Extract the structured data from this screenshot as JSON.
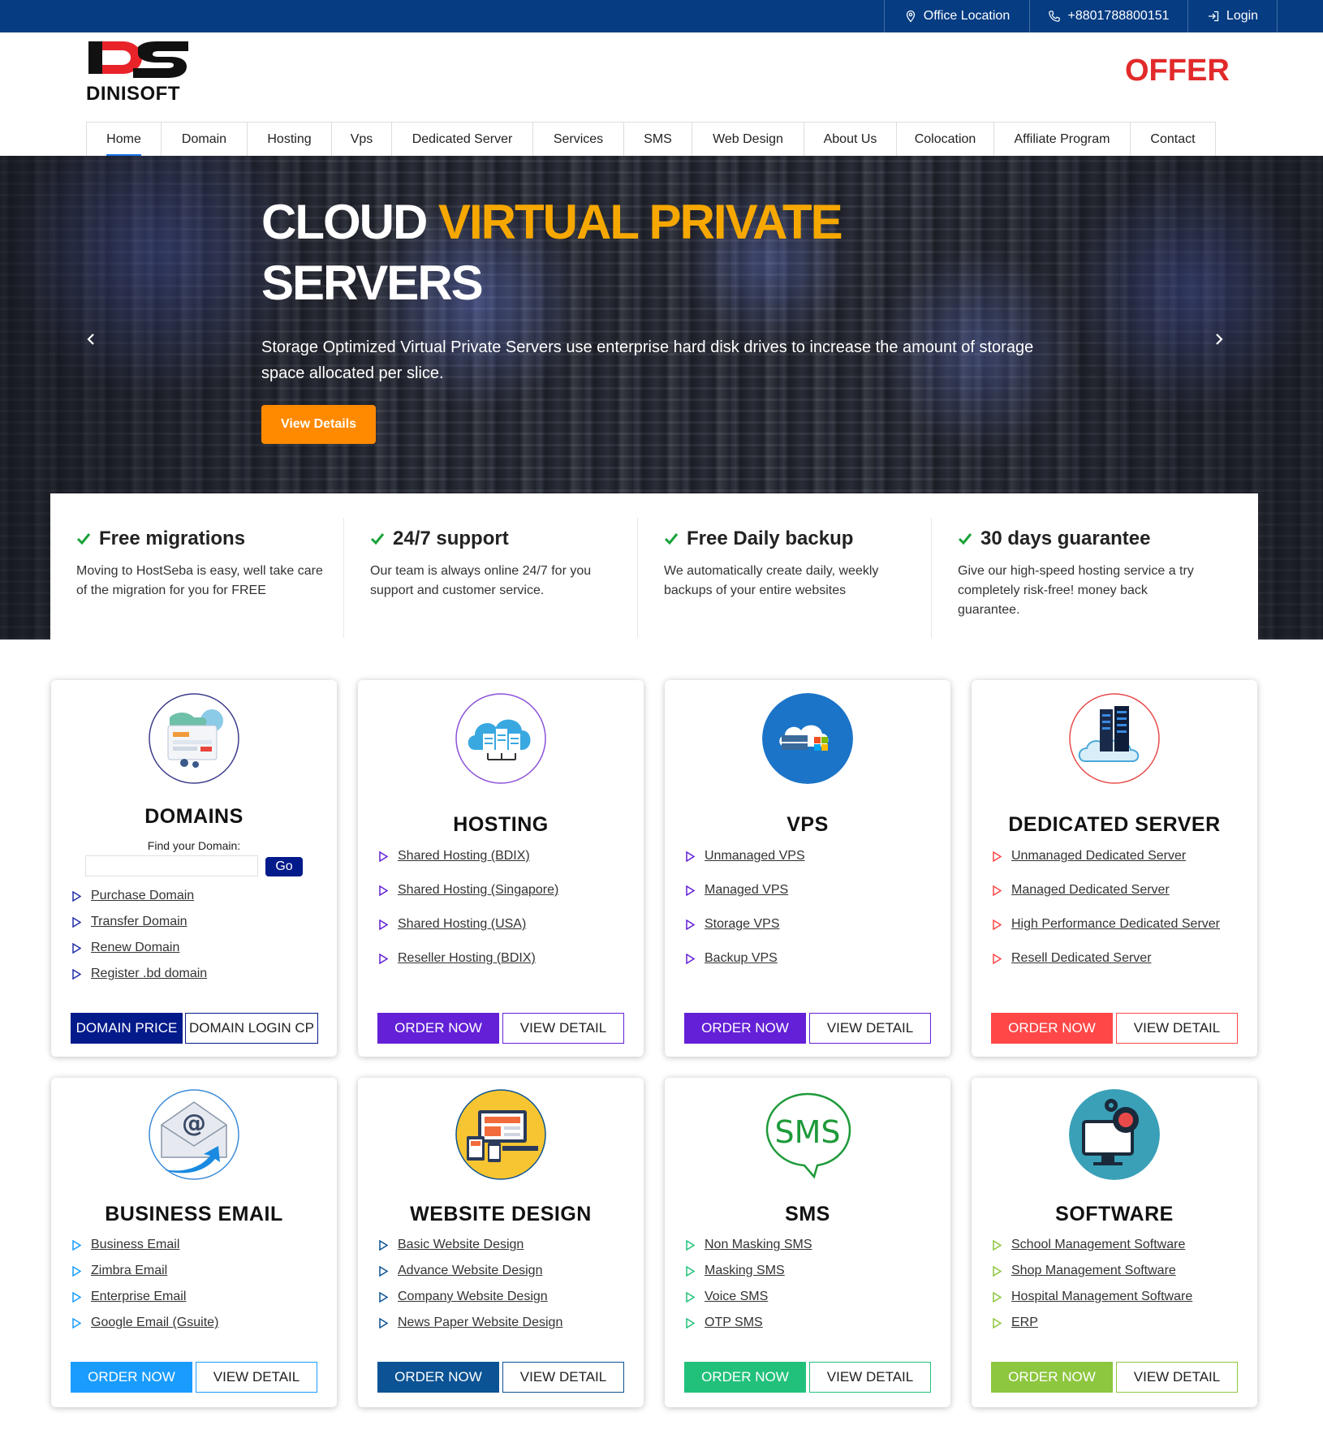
{
  "topbar": {
    "office": "Office Location",
    "phone": "+8801788800151",
    "login": "Login"
  },
  "header": {
    "brand": "DINISOFT",
    "offer": "OFFER"
  },
  "nav": [
    "Home",
    "Domain",
    "Hosting",
    "Vps",
    "Dedicated Server",
    "Services",
    "SMS",
    "Web Design",
    "About Us",
    "Colocation",
    "Affiliate Program",
    "Contact"
  ],
  "hero": {
    "title_white": "CLOUD",
    "title_highlight": "VIRTUAL PRIVATE",
    "title_line2": "SERVERS",
    "subtitle": "Storage Optimized Virtual Private Servers use enterprise hard disk drives to increase the amount of storage space allocated per slice.",
    "button": "View Details"
  },
  "features": [
    {
      "title": "Free migrations",
      "text": "Moving to HostSeba is easy, well take care of the migration for you for FREE"
    },
    {
      "title": "24/7 support",
      "text": "Our team is always online 24/7 for you support and customer service."
    },
    {
      "title": "Free Daily backup",
      "text": "We automatically create daily, weekly backups of your entire websites"
    },
    {
      "title": "30 days guarantee",
      "text": "Give our high-speed hosting service a try completely risk-free! money back guarantee."
    }
  ],
  "domains": {
    "title": "DOMAINS",
    "find_label": "Find your Domain:",
    "go": "Go",
    "links": [
      "Purchase Domain",
      "Transfer Domain",
      "Renew Domain",
      "Register .bd domain"
    ],
    "btn1": "DOMAIN PRICE",
    "btn2": "DOMAIN LOGIN CP"
  },
  "hosting": {
    "title": "HOSTING",
    "links": [
      "Shared Hosting (BDIX)",
      "Shared Hosting (Singapore)",
      "Shared Hosting (USA)",
      "Reseller Hosting (BDIX)"
    ],
    "btn1": "ORDER NOW",
    "btn2": "VIEW DETAIL"
  },
  "vps": {
    "title": "VPS",
    "links": [
      "Unmanaged VPS",
      "Managed VPS",
      "Storage VPS",
      "Backup VPS"
    ],
    "btn1": "ORDER NOW",
    "btn2": "VIEW DETAIL"
  },
  "dedicated": {
    "title": "DEDICATED SERVER",
    "links": [
      "Unmanaged Dedicated Server",
      "Managed Dedicated Server",
      "High Performance Dedicated Server",
      "Resell Dedicated Server"
    ],
    "btn1": "ORDER NOW",
    "btn2": "VIEW DETAIL"
  },
  "email": {
    "title": "BUSINESS EMAIL",
    "links": [
      "Business Email",
      "Zimbra Email",
      "Enterprise Email",
      "Google Email (Gsuite)"
    ],
    "btn1": "ORDER NOW",
    "btn2": "VIEW DETAIL"
  },
  "webdesign": {
    "title": "WEBSITE DESIGN",
    "links": [
      "Basic Website Design",
      "Advance Website Design",
      "Company Website Design",
      "News Paper Website Design"
    ],
    "btn1": "ORDER NOW",
    "btn2": "VIEW DETAIL"
  },
  "sms": {
    "title": "SMS",
    "icon_text": "SMS",
    "links": [
      "Non Masking SMS",
      "Masking SMS",
      "Voice SMS",
      "OTP SMS"
    ],
    "btn1": "ORDER NOW",
    "btn2": "VIEW DETAIL"
  },
  "software": {
    "title": "SOFTWARE",
    "links": [
      "School Management Software",
      "Shop Management Software",
      "Hospital Management Software",
      "ERP"
    ],
    "btn1": "ORDER NOW",
    "btn2": "VIEW DETAIL"
  },
  "colors": {
    "topbar": "#053c82",
    "offer": "#e22a2a",
    "hero_highlight": "#f7a800",
    "hero_button": "#ff8a00",
    "domain_btn": "#031a8a",
    "hosting_btn": "#6320d6",
    "dedicated_btn": "#ff4747",
    "email_btn": "#1a9cff",
    "webdesign_btn": "#0b5394",
    "sms_btn": "#22c17b",
    "software_btn": "#8dc63f"
  }
}
